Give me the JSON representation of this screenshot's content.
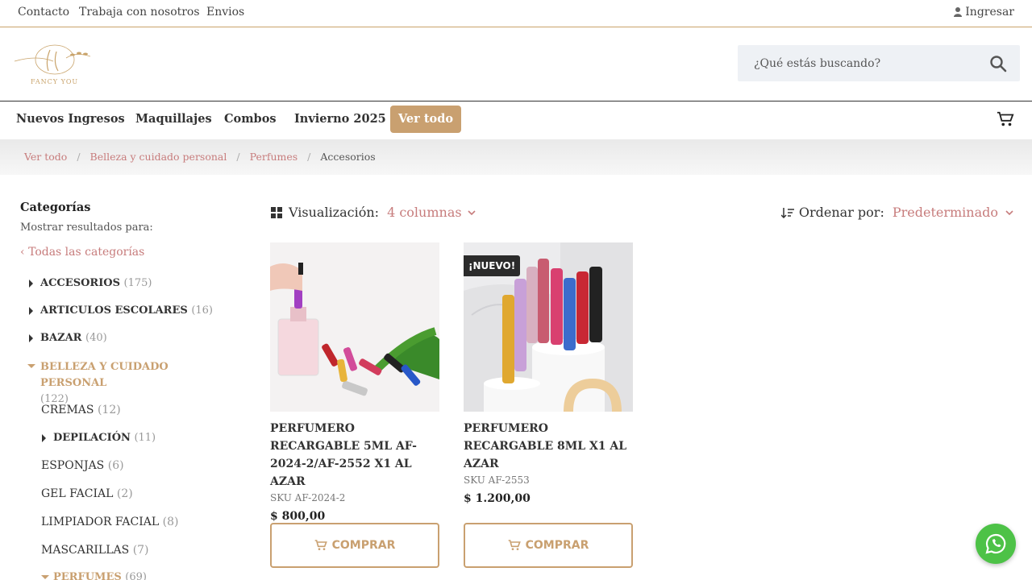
{
  "topbar": {
    "links": [
      "Contacto",
      "Trabaja con nosotros",
      "Envios"
    ],
    "login": "Ingresar"
  },
  "header": {
    "logo_text": "FANCY YOU",
    "search_placeholder": "¿Qué estás buscando?"
  },
  "nav": {
    "items": [
      "Nuevos Ingresos",
      "Maquillajes",
      "Combos",
      "Invierno 2025"
    ],
    "cta": "Ver todo"
  },
  "breadcrumb": [
    "Ver todo",
    "Belleza y cuidado personal",
    "Perfumes",
    "Accesorios"
  ],
  "sidebar": {
    "title": "Categorías",
    "subtitle": "Mostrar resultados para:",
    "all_link": "Todas las categorías",
    "categories": [
      {
        "label": "ACCESORIOS",
        "count": "(175)"
      },
      {
        "label": "ARTICULOS ESCOLARES",
        "count": "(16)"
      },
      {
        "label": "BAZAR",
        "count": "(40)"
      },
      {
        "label": "BELLEZA Y CUIDADO PERSONAL",
        "count": "(122)"
      }
    ],
    "subcategories": [
      {
        "label": "CREMAS",
        "count": "(12)"
      },
      {
        "label": "DEPILACIÓN",
        "count": "(11)"
      },
      {
        "label": "ESPONJAS",
        "count": "(6)"
      },
      {
        "label": "GEL FACIAL",
        "count": "(2)"
      },
      {
        "label": "LIMPIADOR FACIAL",
        "count": "(8)"
      },
      {
        "label": "MASCARILLAS",
        "count": "(7)"
      },
      {
        "label": "PERFUMES",
        "count": "(69)"
      }
    ]
  },
  "toolbar": {
    "view_label": "Visualización:",
    "view_value": "4 columnas",
    "sort_label": "Ordenar por:",
    "sort_value": "Predeterminado"
  },
  "products": [
    {
      "name": "PERFUMERO RECARGABLE 5ML AF-2024-2/AF-2552 X1 AL AZAR",
      "sku": "SKU AF-2024-2",
      "price": "$  800,00",
      "buy": "COMPRAR",
      "badge": ""
    },
    {
      "name": "PERFUMERO RECARGABLE 8ML X1 AL AZAR",
      "sku": "SKU AF-2553",
      "price": "$  1.200,00",
      "buy": "COMPRAR",
      "badge": "¡NUEVO!"
    }
  ],
  "colors": {
    "accent": "#c9a070",
    "link": "#c77c7c",
    "whatsapp": "#4dc247"
  }
}
